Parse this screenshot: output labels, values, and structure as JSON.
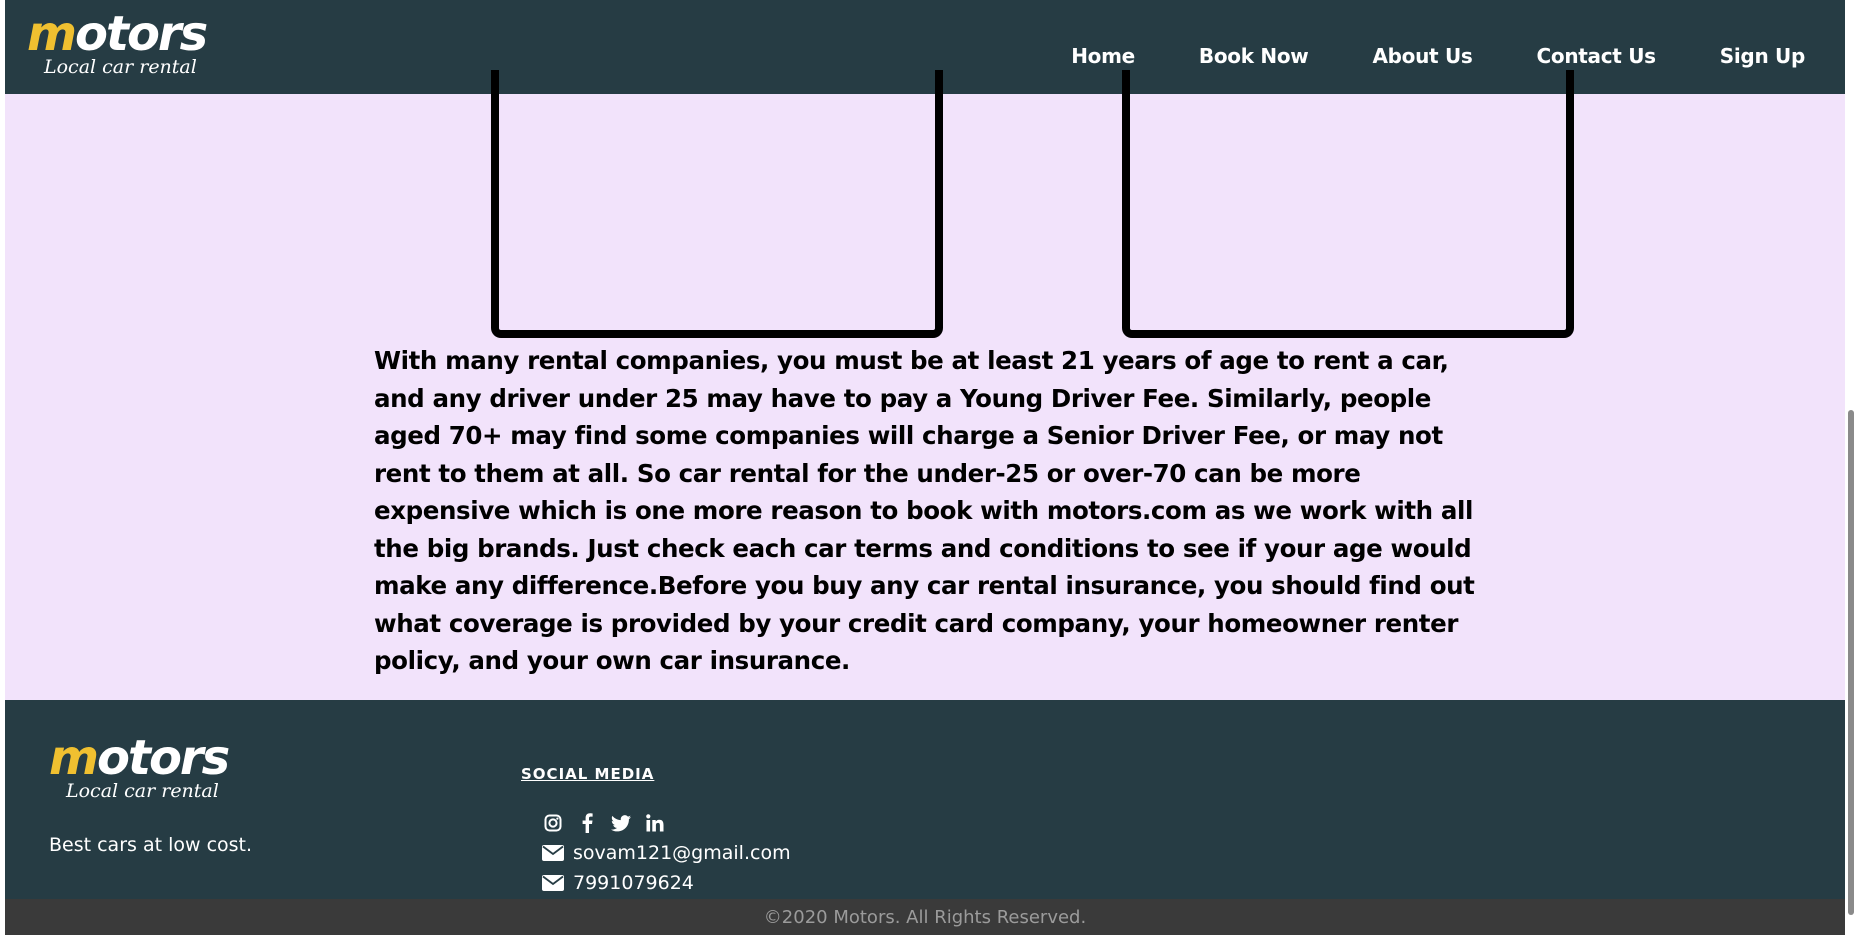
{
  "navbar": {
    "logo": {
      "text_accent": "m",
      "text_rest": "otors",
      "subtitle": "Local car rental"
    },
    "links": [
      "Home",
      "Book Now",
      "About Us",
      "Contact Us",
      "Sign Up"
    ]
  },
  "content": {
    "paragraph": "With many rental companies, you must be at least 21 years of age to rent a car, and any driver under 25 may have to pay a Young Driver Fee. Similarly, people aged 70+ may find some companies will charge a Senior Driver Fee, or may not rent to them at all. So car rental for the under-25 or over-70 can be more expensive which is one more reason to book with motors.com as we work with all the big brands. Just check each car terms and conditions to see if your age would make any difference.Before you buy any car rental insurance, you should find out what coverage is provided by your credit card company, your homeowner renter policy, and your own car insurance."
  },
  "footer": {
    "logo": {
      "text_accent": "m",
      "text_rest": "otors",
      "subtitle": "Local car rental"
    },
    "tagline": "Best cars at low cost.",
    "social_heading": "SOCIAL MEDIA",
    "social_icons": [
      "instagram-icon",
      "facebook-icon",
      "twitter-icon",
      "linkedin-icon"
    ],
    "email": "sovam121@gmail.com",
    "phone": "7991079624",
    "copyright": "©2020 Motors. All Rights Reserved."
  },
  "colors": {
    "navbar_bg": "#263c44",
    "page_bg": "#f2e3fb",
    "logo_accent": "#f0c030",
    "copyright_bg": "#3a3a3a"
  }
}
